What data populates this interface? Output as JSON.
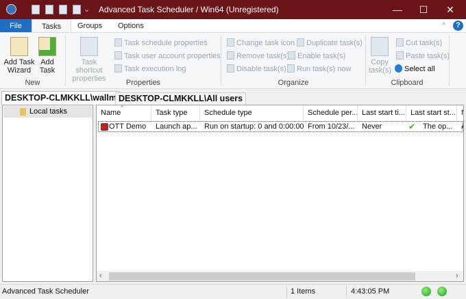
{
  "window": {
    "title": "Advanced Task Scheduler / Win64 (Unregistered)",
    "controls": {
      "minimize": "—",
      "maximize": "☐",
      "close": "✕"
    }
  },
  "menu": {
    "tabs": [
      "File",
      "Tasks",
      "Groups",
      "Options"
    ],
    "help": "?",
    "collapse": "^"
  },
  "ribbon": {
    "new": {
      "label": "New",
      "add_task_wizard": "Add Task Wizard",
      "add_task": "Add Task"
    },
    "properties": {
      "label": "Properties",
      "task_shortcut_properties": "Task shortcut properties",
      "items": [
        "Task schedule properties",
        "Task user account properties",
        "Task execution log"
      ]
    },
    "organize": {
      "label": "Organize",
      "col1": [
        "Change task icon",
        "Remove task(s)",
        "Disable task(s)"
      ],
      "col2": [
        "Duplicate task(s)",
        "Enable task(s)",
        "Run task(s) now"
      ]
    },
    "clipboard": {
      "label": "Clipboard",
      "copy": "Copy task(s)",
      "items": [
        "Cut task(s)",
        "Paste task(s)",
        "Select all"
      ]
    }
  },
  "user_tabs": [
    "DESKTOP-CLMKKLL\\wallm",
    "DESKTOP-CLMKKLL\\All users"
  ],
  "tree": {
    "items": [
      "Local tasks"
    ]
  },
  "list": {
    "columns": [
      "Name",
      "Task type",
      "Schedule type",
      "Schedule per...",
      "Last start ti...",
      "Last start st...",
      "N"
    ],
    "rows": [
      [
        "OTT Demo",
        "Launch ap...",
        "Run on startup: 0 and 0:00:00",
        "From 10/23/...",
        "Never",
        "The op...",
        "A"
      ]
    ]
  },
  "status": {
    "app": "Advanced Task Scheduler",
    "items": "1 Items",
    "time": "4:43:05 PM"
  },
  "colors": {
    "titlebar": "#6b1518",
    "file_tab": "#1e6fc4",
    "status_ok": "#1ea01a"
  }
}
